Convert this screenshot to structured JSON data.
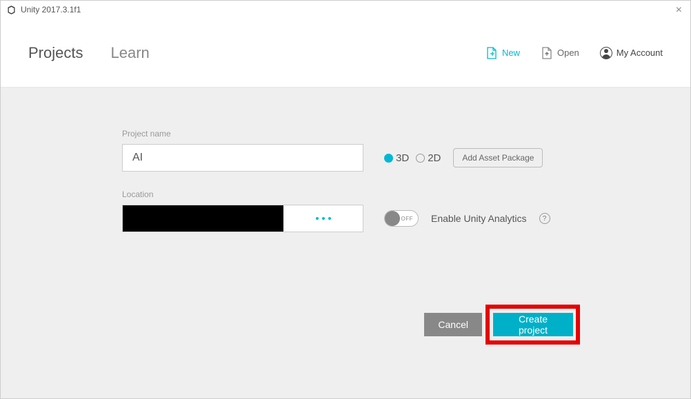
{
  "window": {
    "title": "Unity 2017.3.1f1"
  },
  "header": {
    "tabs": {
      "projects": "Projects",
      "learn": "Learn"
    },
    "actions": {
      "new": "New",
      "open": "Open",
      "account": "My Account"
    }
  },
  "form": {
    "projectName": {
      "label": "Project name",
      "value": "AI"
    },
    "location": {
      "label": "Location"
    },
    "dimension": {
      "opt3d": "3D",
      "opt2d": "2D",
      "selected": "3D"
    },
    "assetPackage": {
      "label": "Add Asset Package"
    },
    "analytics": {
      "toggleState": "OFF",
      "label": "Enable Unity Analytics",
      "help": "?"
    }
  },
  "buttons": {
    "cancel": "Cancel",
    "create": "Create project"
  }
}
